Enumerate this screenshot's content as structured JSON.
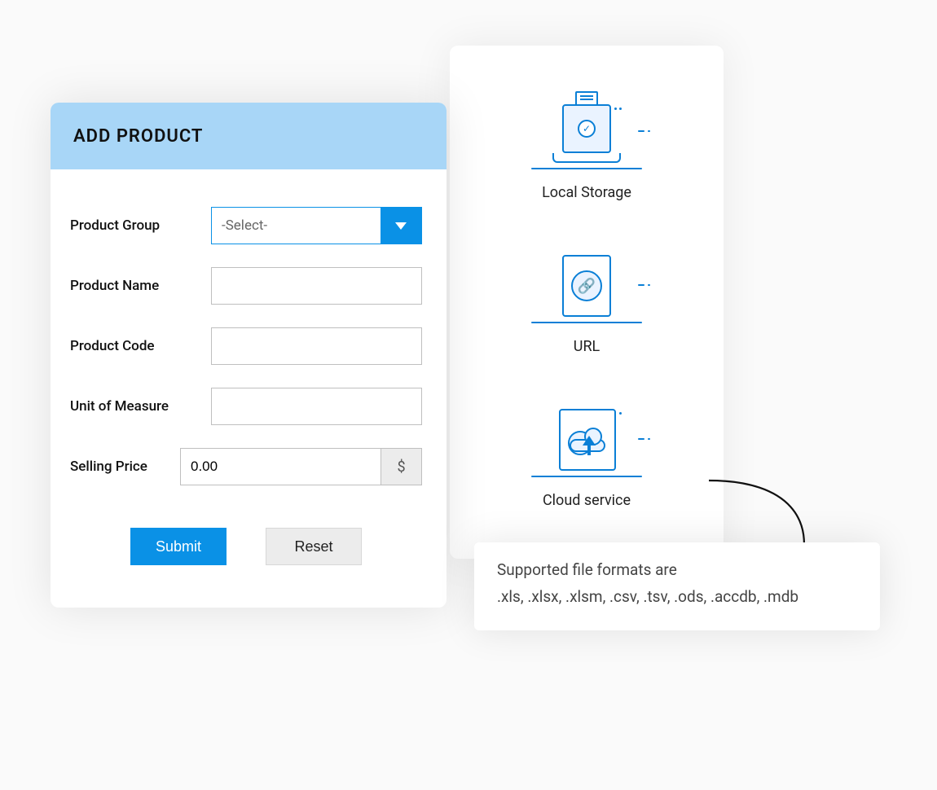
{
  "form": {
    "title": "ADD PRODUCT",
    "fields": {
      "product_group": {
        "label": "Product Group",
        "selected": "-Select-"
      },
      "product_name": {
        "label": "Product Name",
        "value": ""
      },
      "product_code": {
        "label": "Product Code",
        "value": ""
      },
      "unit_of_measure": {
        "label": "Unit of Measure",
        "value": ""
      },
      "selling_price": {
        "label": "Selling Price",
        "value": "0.00",
        "currency_symbol": "$"
      }
    },
    "buttons": {
      "submit": "Submit",
      "reset": "Reset"
    }
  },
  "sources": {
    "local_storage": {
      "label": "Local Storage"
    },
    "url": {
      "label": "URL"
    },
    "cloud_service": {
      "label": "Cloud service"
    }
  },
  "formats": {
    "lead": "Supported file formats are",
    "list": ".xls, .xlsx, .xlsm, .csv, .tsv, .ods, .accdb, .mdb"
  }
}
